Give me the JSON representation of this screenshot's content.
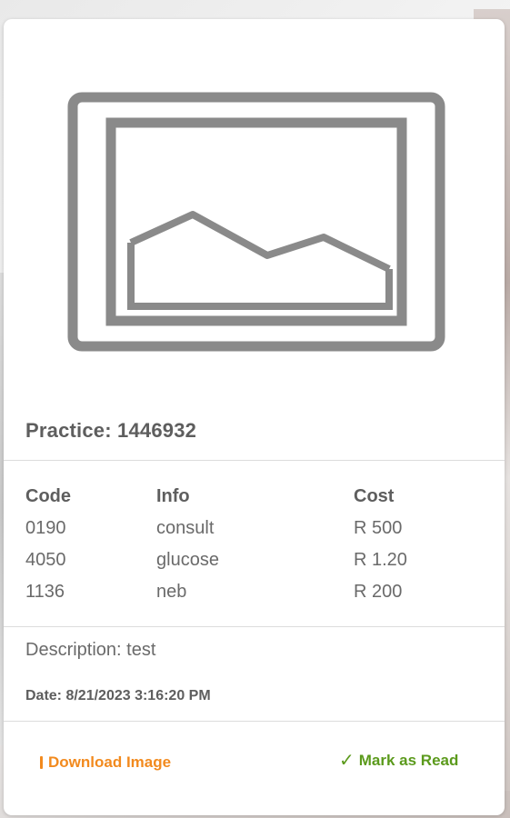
{
  "card": {
    "image": {
      "icon": "image-placeholder-icon"
    },
    "practice_title": "Practice: 1446932",
    "table": {
      "headers": {
        "code": "Code",
        "info": "Info",
        "cost": "Cost"
      },
      "rows": [
        {
          "code": "0190",
          "info": "consult",
          "cost": "R 500"
        },
        {
          "code": "4050",
          "info": "glucose",
          "cost": "R 1.20"
        },
        {
          "code": "1136",
          "info": "neb",
          "cost": "R 200"
        }
      ]
    },
    "description": "Description: test",
    "date": "Date: 8/21/2023 3:16:20 PM",
    "actions": {
      "download_label": "Download Image",
      "download_icon": "download-icon",
      "read_label": "Mark as Read",
      "read_icon": "✓"
    }
  },
  "colors": {
    "download": "#f28a1e",
    "mark_read": "#5b9a1c",
    "text": "#6a6a6a",
    "heading": "#5e5e5e",
    "placeholder_gray": "#8a8a8a"
  }
}
